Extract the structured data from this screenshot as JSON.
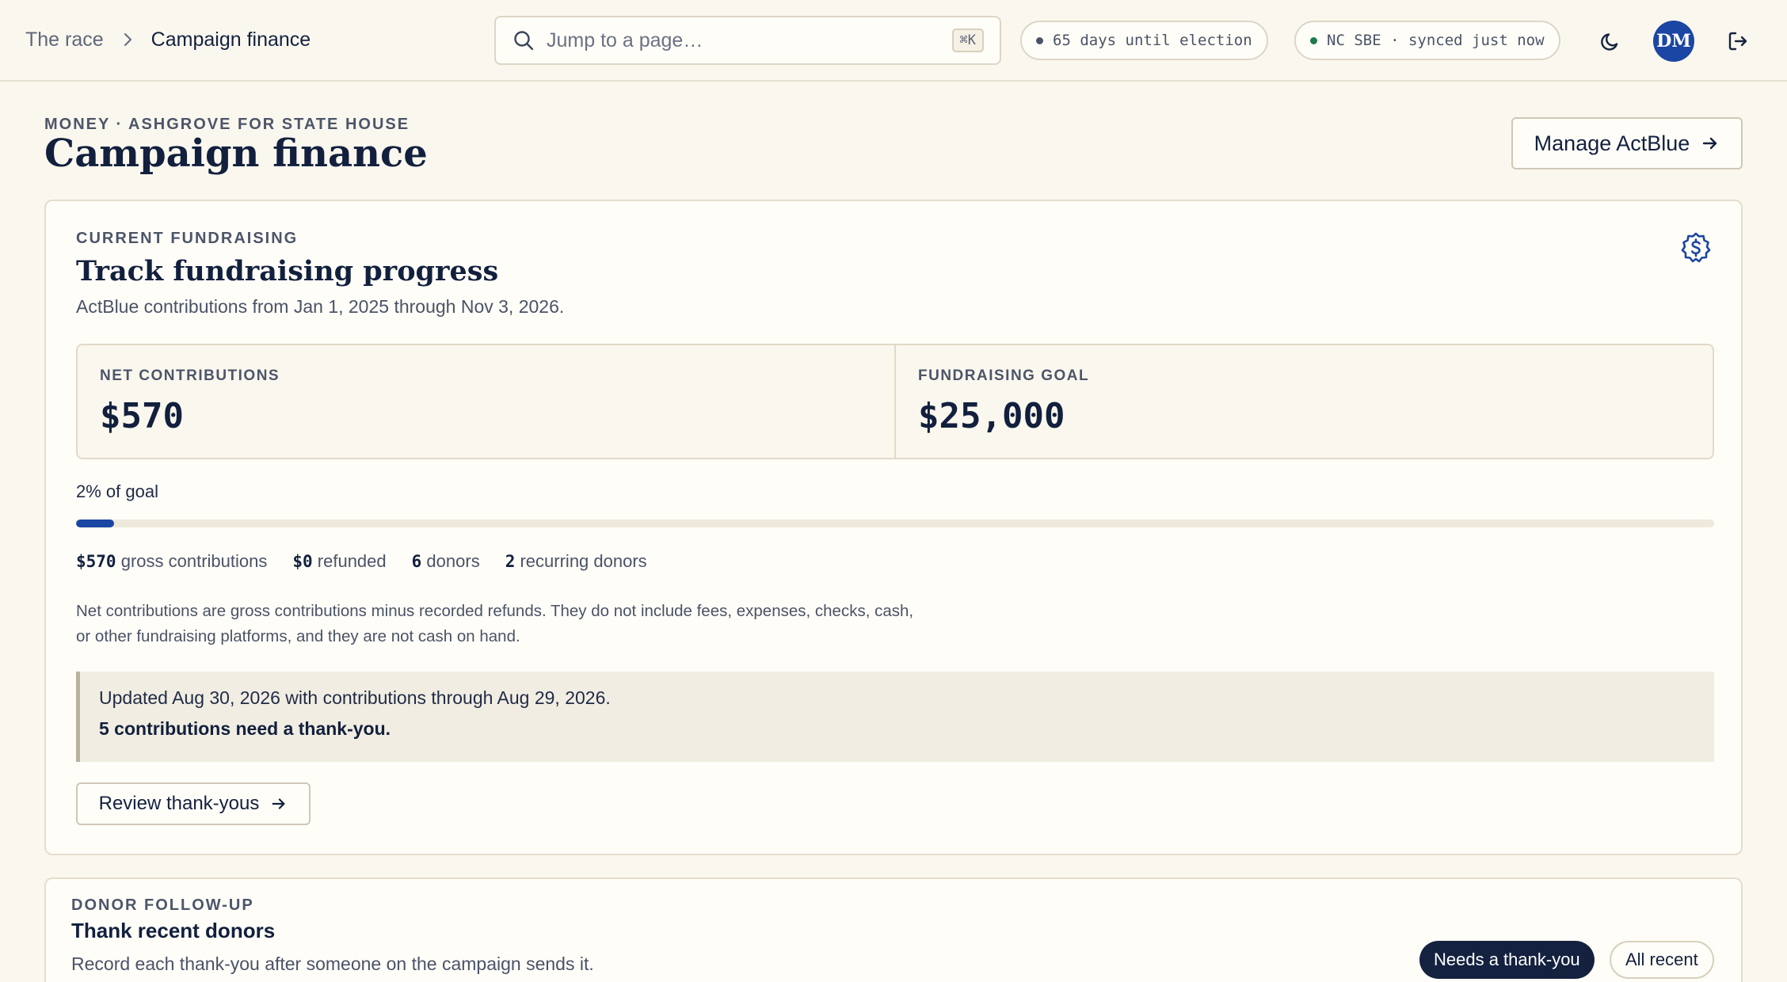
{
  "breadcrumb": {
    "root": "The race",
    "current": "Campaign finance"
  },
  "search": {
    "placeholder": "Jump to a page…",
    "shortcut": "⌘K"
  },
  "status": {
    "election": "65 days until election",
    "election_dot_color": "#4a5366",
    "sync": "NC SBE · synced just now",
    "sync_dot_color": "#1f7a4d"
  },
  "user": {
    "initials": "DM"
  },
  "header": {
    "eyebrow": "MONEY · ASHGROVE FOR STATE HOUSE",
    "title": "Campaign finance",
    "manage_label": "Manage ActBlue"
  },
  "fundraising": {
    "eyebrow": "CURRENT FUNDRAISING",
    "title": "Track fundraising progress",
    "subtitle": "ActBlue contributions from Jan 1, 2025 through Nov 3, 2026.",
    "net_label": "NET CONTRIBUTIONS",
    "net_value": "$570",
    "goal_label": "FUNDRAISING GOAL",
    "goal_value": "$25,000",
    "percent_label": "2% of goal",
    "progress_fraction": 0.023,
    "gross_value": "$570",
    "gross_label": "gross contributions",
    "refunded_value": "$0",
    "refunded_label": "refunded",
    "donors_value": "6",
    "donors_label": "donors",
    "recurring_value": "2",
    "recurring_label": "recurring donors",
    "note_line1": "Net contributions are gross contributions minus recorded refunds. They do not include fees, expenses, checks, cash,",
    "note_line2": "or other fundraising platforms, and they are not cash on hand.",
    "updated": "Updated Aug 30, 2026 with contributions through Aug 29, 2026.",
    "thankyou_needed": "5 contributions need a thank-you.",
    "review_label": "Review thank-yous"
  },
  "followup": {
    "eyebrow": "DONOR FOLLOW-UP",
    "title": "Thank recent donors",
    "subtitle": "Record each thank-you after someone on the campaign sends it.",
    "filter_active": "Needs a thank-you",
    "filter_all": "All recent"
  },
  "colors": {
    "accent": "#1c46a3",
    "ink": "#12203e",
    "background": "#faf7ee"
  }
}
